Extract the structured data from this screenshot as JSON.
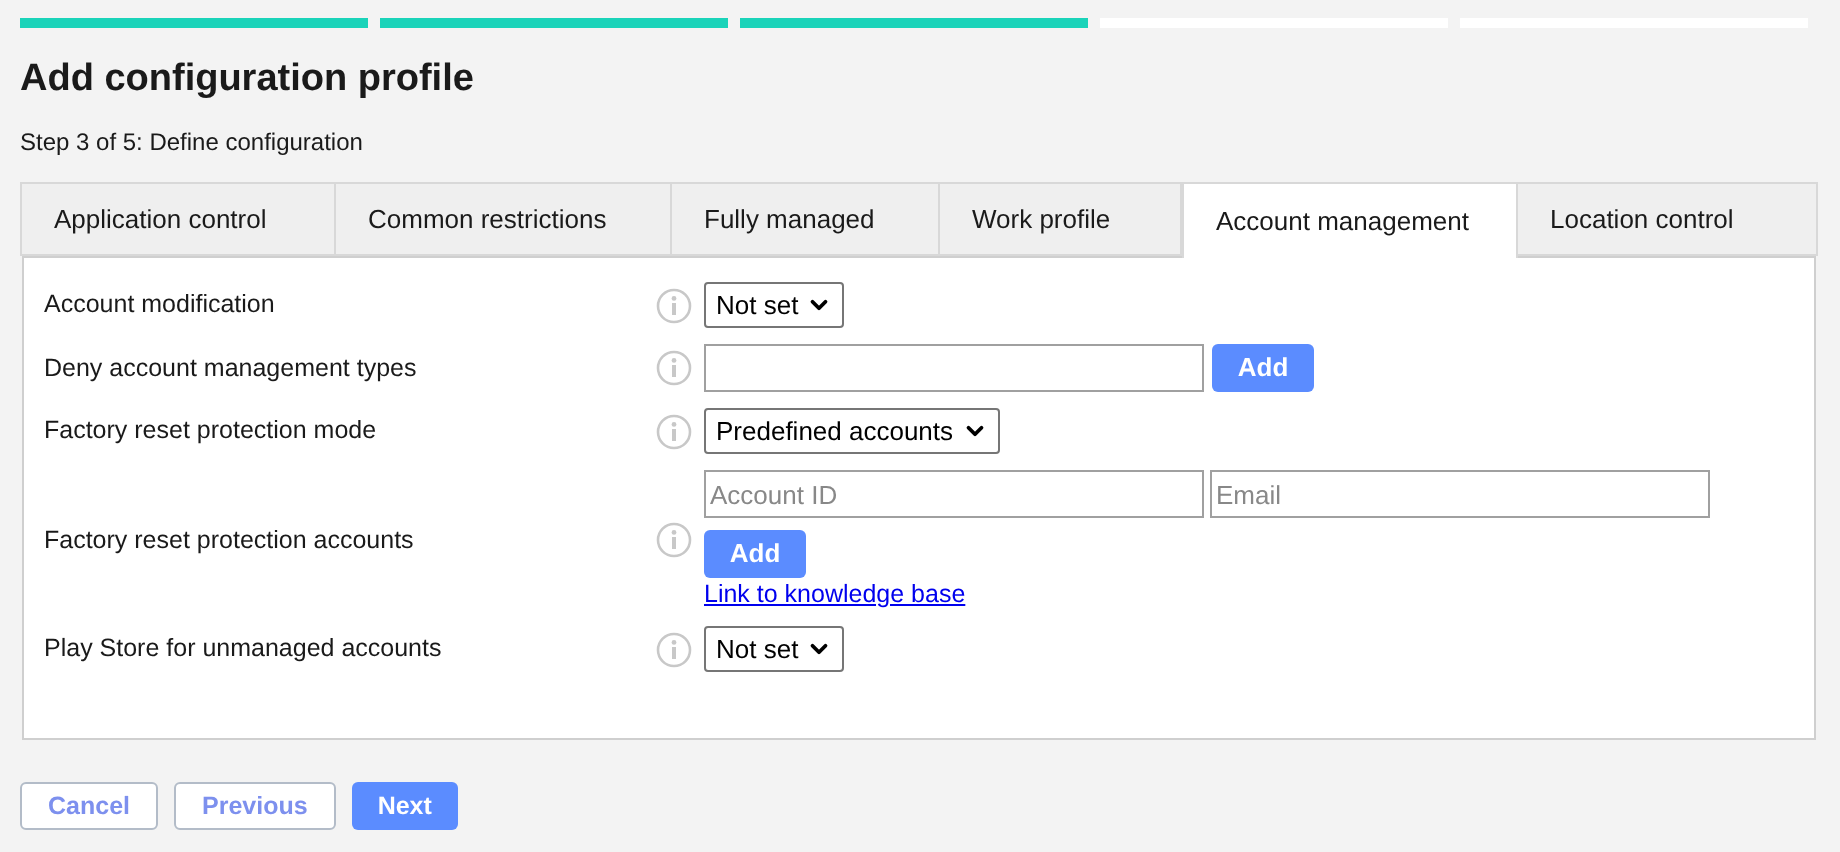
{
  "progress": [
    {
      "done": true
    },
    {
      "done": true
    },
    {
      "done": true
    },
    {
      "done": false
    },
    {
      "done": false
    }
  ],
  "title": "Add configuration profile",
  "step": "Step 3 of 5: Define configuration",
  "tabs": [
    {
      "label": "Application control",
      "selected": false
    },
    {
      "label": "Common restrictions",
      "selected": false
    },
    {
      "label": "Fully managed",
      "selected": false
    },
    {
      "label": "Work profile",
      "selected": false
    },
    {
      "label": "Account management",
      "selected": true
    },
    {
      "label": "Location control",
      "selected": false
    }
  ],
  "settings": [
    {
      "kind": "select",
      "label": "Account modification",
      "value": "Not set"
    },
    {
      "kind": "text_add",
      "label": "Deny account management types",
      "button": "Add"
    },
    {
      "kind": "select",
      "label": "Factory reset protection mode",
      "value": "Predefined accounts"
    },
    {
      "kind": "accounts",
      "label": "Factory reset protection accounts",
      "fields": [
        {
          "placeholder": "Account ID"
        },
        {
          "placeholder": "Email"
        }
      ],
      "button": "Add",
      "link": "Link to knowledge base"
    },
    {
      "kind": "select",
      "label": "Play Store for unmanaged accounts",
      "value": "Not set"
    }
  ],
  "buttons": [
    {
      "label": "Cancel",
      "kind": "secondary"
    },
    {
      "label": "Previous",
      "kind": "secondary"
    },
    {
      "label": "Next",
      "kind": "primary"
    }
  ]
}
